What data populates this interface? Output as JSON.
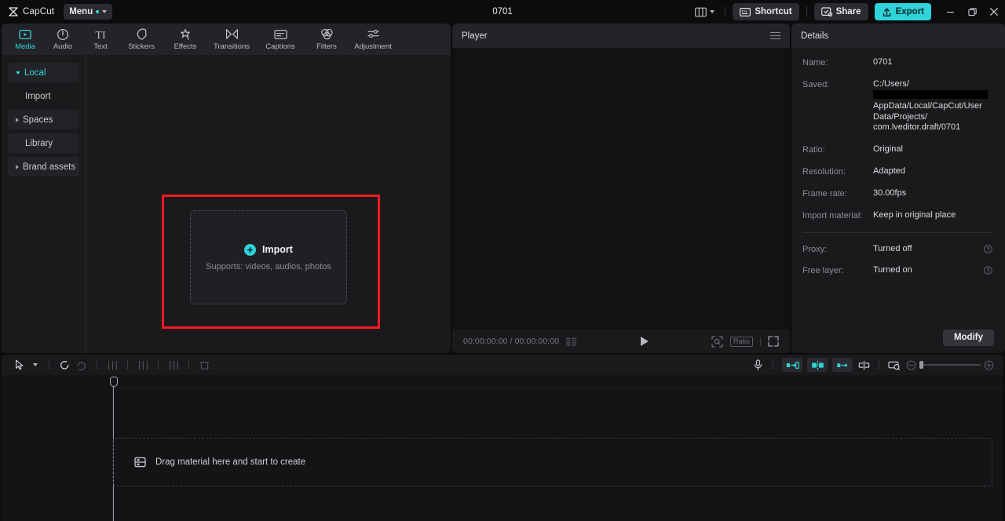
{
  "titlebar": {
    "brand": "CapCut",
    "menu_label": "Menu",
    "project_title": "0701",
    "shortcut_label": "Shortcut",
    "share_label": "Share",
    "export_label": "Export",
    "accent": "#2fd4da"
  },
  "tabs": [
    {
      "label": "Media",
      "icon": "media-icon",
      "active": true
    },
    {
      "label": "Audio",
      "icon": "audio-icon",
      "active": false
    },
    {
      "label": "Text",
      "icon": "text-icon",
      "active": false
    },
    {
      "label": "Stickers",
      "icon": "stickers-icon",
      "active": false
    },
    {
      "label": "Effects",
      "icon": "effects-icon",
      "active": false
    },
    {
      "label": "Transitions",
      "icon": "transitions-icon",
      "active": false
    },
    {
      "label": "Captions",
      "icon": "captions-icon",
      "active": false
    },
    {
      "label": "Filters",
      "icon": "filters-icon",
      "active": false
    },
    {
      "label": "Adjustment",
      "icon": "adjustment-icon",
      "active": false
    }
  ],
  "sidebar": {
    "items": [
      {
        "label": "Local",
        "expandable": true,
        "expanded": true,
        "active": true
      },
      {
        "label": "Import",
        "expandable": false,
        "expanded": false,
        "active": false
      },
      {
        "label": "Spaces",
        "expandable": true,
        "expanded": false,
        "active": false
      },
      {
        "label": "Library",
        "expandable": false,
        "expanded": false,
        "active": false
      },
      {
        "label": "Brand assets",
        "expandable": true,
        "expanded": false,
        "active": false
      }
    ]
  },
  "dropzone": {
    "import_label": "Import",
    "supports_text": "Supports: videos, audios, photos",
    "highlight_color": "#fc1921"
  },
  "player": {
    "title": "Player",
    "current_time": "00:00:00:00",
    "total_time": "00:00:00:00",
    "time_display": "00:00:00:00 / 00:00:00:00",
    "ratio_label": "Ratio"
  },
  "details": {
    "title": "Details",
    "rows": [
      {
        "key": "Name:",
        "value": "0701"
      },
      {
        "key": "Saved:",
        "value": "C:/Users/"
      },
      {
        "key": "Ratio:",
        "value": "Original"
      },
      {
        "key": "Resolution:",
        "value": "Adapted"
      },
      {
        "key": "Frame rate:",
        "value": "30.00fps"
      },
      {
        "key": "Import material:",
        "value": "Keep in original place"
      }
    ],
    "saved_path_lines": [
      "AppData/Local/CapCut/User",
      "Data/Projects/",
      "com.lveditor.draft/0701"
    ],
    "toggles": [
      {
        "key": "Proxy:",
        "value": "Turned off"
      },
      {
        "key": "Free layer:",
        "value": "Turned on"
      }
    ],
    "modify_label": "Modify"
  },
  "timeline": {
    "empty_message": "Drag material here and start to create",
    "tools": [
      {
        "name": "select-tool",
        "enabled": true
      },
      {
        "name": "undo-tool",
        "enabled": true
      },
      {
        "name": "redo-tool",
        "enabled": false
      },
      {
        "name": "split-tool",
        "enabled": false
      },
      {
        "name": "trim-left-tool",
        "enabled": false
      },
      {
        "name": "trim-right-tool",
        "enabled": false
      },
      {
        "name": "delete-tool",
        "enabled": false
      }
    ],
    "right_tools": [
      {
        "name": "record-voiceover-icon"
      },
      {
        "name": "auto-cut-icon"
      },
      {
        "name": "mirror-icon"
      },
      {
        "name": "crop-icon"
      },
      {
        "name": "freeze-icon"
      },
      {
        "name": "snapshot-icon"
      }
    ],
    "zoom_out_label": "−",
    "zoom_in_label": "+"
  }
}
